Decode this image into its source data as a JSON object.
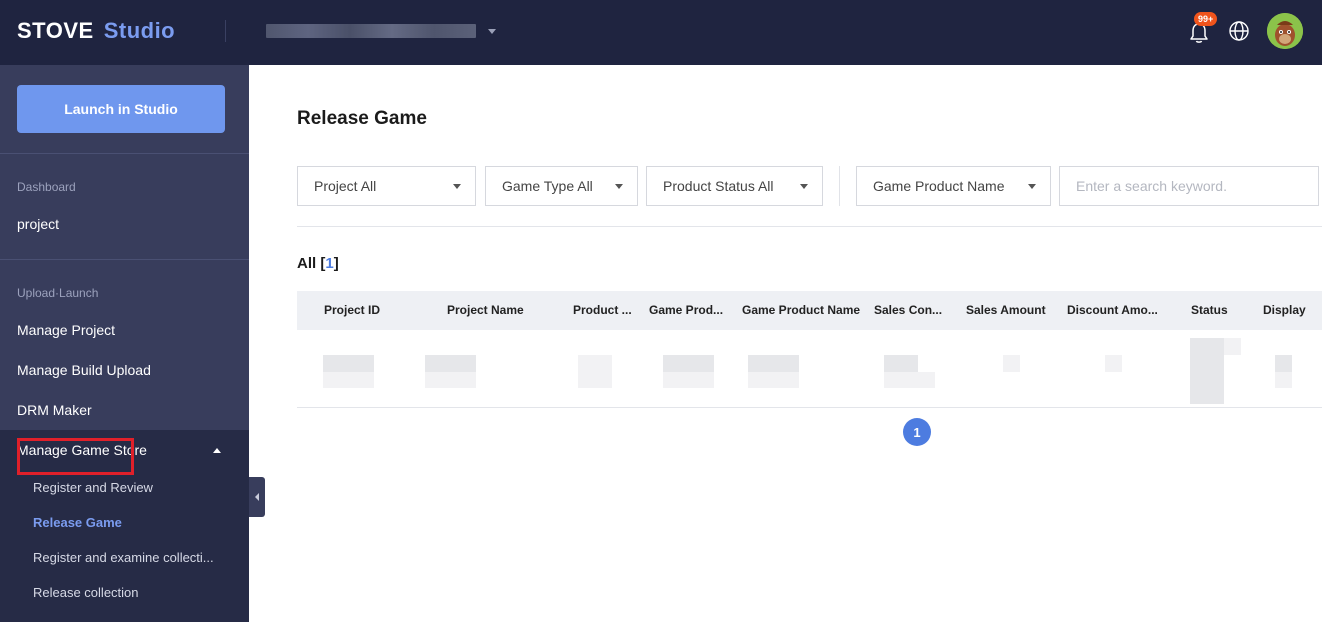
{
  "header": {
    "brand_primary": "STOVE",
    "brand_secondary": "Studio",
    "notification_badge": "99+"
  },
  "sidebar": {
    "launch_button": "Launch in Studio",
    "sections": [
      {
        "title": "Dashboard",
        "items": [
          "project"
        ]
      },
      {
        "title": "Upload·Launch",
        "items": [
          "Manage Project",
          "Manage Build Upload",
          "DRM Maker"
        ]
      }
    ],
    "group": {
      "label": "Manage Game Store",
      "subitems": [
        "Register and Review",
        "Release Game",
        "Register and examine collecti...",
        "Release collection"
      ],
      "active_index": 1
    }
  },
  "main": {
    "title": "Release Game",
    "filters": [
      "Project All",
      "Game Type All",
      "Product Status All",
      "Game Product Name"
    ],
    "search_placeholder": "Enter a search keyword.",
    "count_label": "All",
    "count_value": "1",
    "columns": [
      "Project ID",
      "Project Name",
      "Product ...",
      "Game Prod...",
      "Game Product Name",
      "Sales Con...",
      "Sales Amount",
      "Discount Amo...",
      "Status",
      "Display"
    ],
    "page_number": "1"
  },
  "colors": {
    "topbar": "#1f2440",
    "sidebar": "#383d5c",
    "accent": "#6f97ee",
    "highlight": "#e0202a"
  }
}
